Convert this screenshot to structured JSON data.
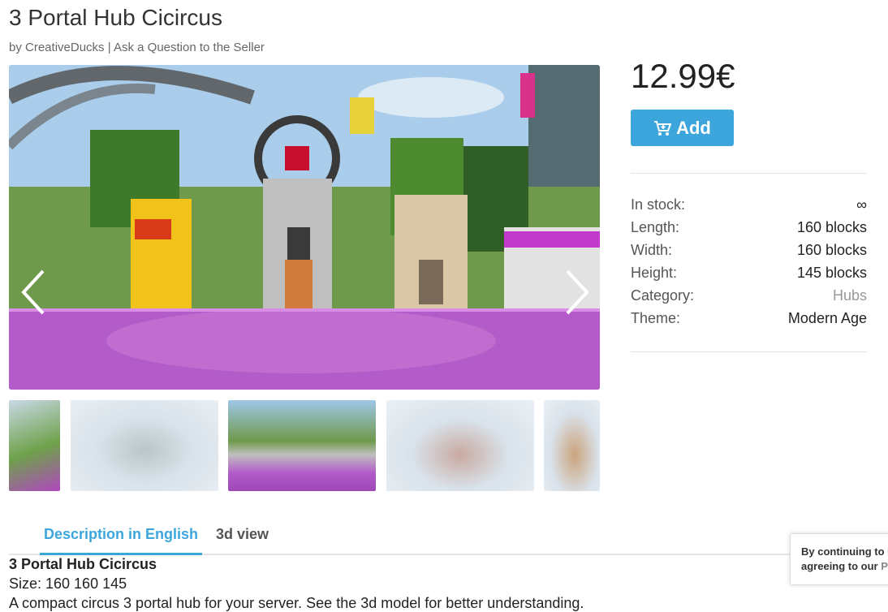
{
  "product": {
    "title": "3 Portal Hub Cicircus",
    "by_prefix": "by",
    "seller": "CreativeDucks",
    "separator": "|",
    "ask_link": "Ask a Question to the Seller",
    "price": "12.99€",
    "add_label": "Add"
  },
  "specs": [
    {
      "label": "In stock:",
      "value": "∞"
    },
    {
      "label": "Length:",
      "value": "160 blocks"
    },
    {
      "label": "Width:",
      "value": "160 blocks"
    },
    {
      "label": "Height:",
      "value": "145 blocks"
    },
    {
      "label": "Category:",
      "value": "Hubs"
    },
    {
      "label": "Theme:",
      "value": "Modern Age"
    }
  ],
  "gallery": {
    "prev_icon": "chevron-left-icon",
    "next_icon": "chevron-right-icon",
    "thumbnail_count": 5
  },
  "tabs": [
    {
      "label": "Description in English",
      "active": true
    },
    {
      "label": "3d view",
      "active": false
    }
  ],
  "description": {
    "title": "3 Portal Hub Cicircus",
    "size": "Size: 160 160 145",
    "text": "A compact circus 3 portal hub for your server. See the 3d model for better understanding."
  },
  "cookie": {
    "line1": "By continuing to u",
    "line2_prefix": "agreeing to our ",
    "line2_link": "Pr"
  },
  "colors": {
    "accent": "#3ca6dc",
    "text": "#222222",
    "muted": "#666666"
  }
}
